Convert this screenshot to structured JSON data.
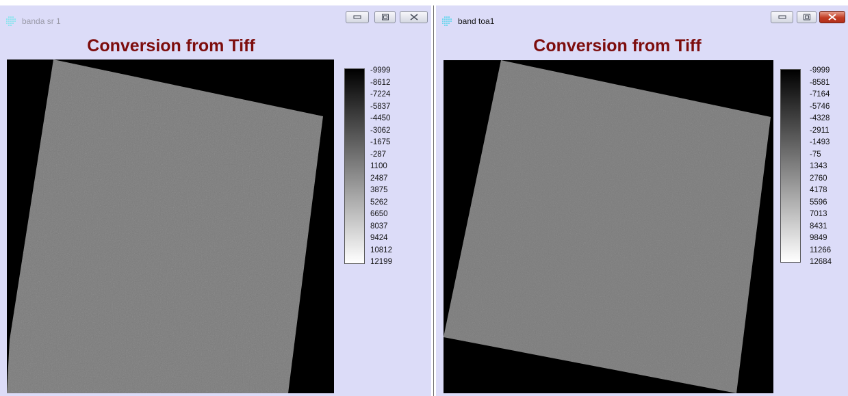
{
  "windows": [
    {
      "title": "banda sr 1",
      "heading": "Conversion from Tiff",
      "colorbar_labels": [
        "-9999",
        "-8612",
        "-7224",
        "-5837",
        "-4450",
        "-3062",
        "-1675",
        "-287",
        "1100",
        "2487",
        "3875",
        "5262",
        "6650",
        "8037",
        "9424",
        "10812",
        "12199"
      ],
      "active": false
    },
    {
      "title": "band toa1",
      "heading": "Conversion from Tiff",
      "colorbar_labels": [
        "-9999",
        "-8581",
        "-7164",
        "-5746",
        "-4328",
        "-2911",
        "-1493",
        "-75",
        "1343",
        "2760",
        "4178",
        "5596",
        "7013",
        "8431",
        "9849",
        "11266",
        "12684"
      ],
      "active": true
    }
  ],
  "icons": {
    "app": "app-grid-icon",
    "minimize": "minimize-icon",
    "maximize": "maximize-icon",
    "close": "close-icon"
  },
  "colors": {
    "window_bg": "#dcdcf8",
    "heading": "#7d0d0d",
    "close_active": "#c23c24",
    "image_bg": "#000000",
    "scene_gray": "#7a7a7a"
  }
}
